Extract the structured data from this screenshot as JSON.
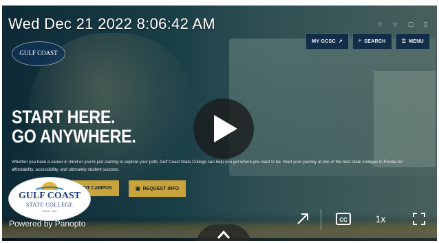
{
  "overlay": {
    "datetime": "Wed Dec 21 2022 8:06:42 AM"
  },
  "site_nav": {
    "my_gcsc": "MY GCSC",
    "search": "SEARCH",
    "menu": "MENU"
  },
  "hero": {
    "headline_line1": "START HERE.",
    "headline_line2": "GO ANYWHERE.",
    "body": "Whether you have a career in mind or you're just starting to explore your path, Gulf Coast State College can help you get where you want to be. Start your journey at one of the best state colleges in Florida for affordability, accessibility, and ultimately student success.",
    "cta_visit": "VISIT CAMPUS",
    "cta_request": "REQUEST INFO"
  },
  "logo": {
    "name": "GULF COAST",
    "subtitle": "STATE COLLEGE",
    "since": "SINCE 1957"
  },
  "player": {
    "powered_by": "Powered by Panopto",
    "speed": "1x"
  },
  "icons": [
    "play-icon",
    "popout-icon",
    "cc-icon",
    "fullscreen-icon",
    "chevron-up-icon",
    "search-icon",
    "menu-icon",
    "external-link-icon"
  ],
  "colors": {
    "accent_gold": "#c9a43a",
    "navy": "#1b3d7a"
  }
}
